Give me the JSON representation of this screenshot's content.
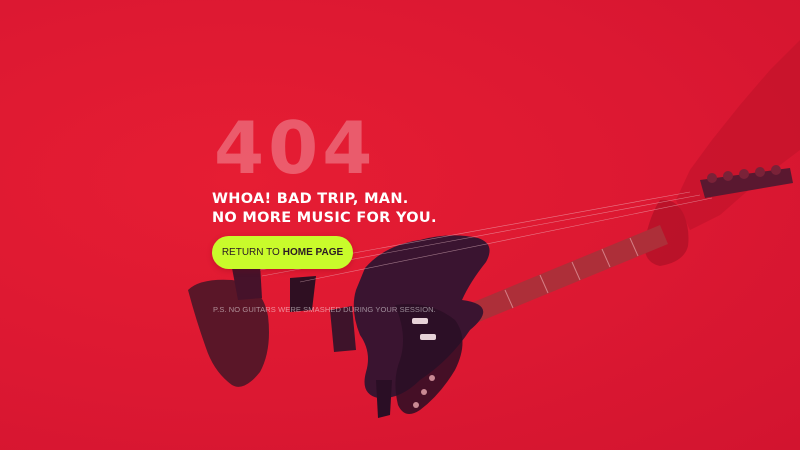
{
  "error": {
    "code": "404",
    "headline_line1": "WHOA! BAD TRIP, MAN.",
    "headline_line2": "NO MORE MUSIC FOR YOU."
  },
  "button": {
    "prefix": "RETURN TO",
    "emphasis": "HOME PAGE"
  },
  "footnote": "P.S. NO GUITARS WERE SMASHED DURING YOUR SESSION.",
  "colors": {
    "background": "#e21a33",
    "button": "#c9fb2b",
    "guitar_dark": "#3a1430"
  },
  "illustration": "guitar-being-smashed-image"
}
